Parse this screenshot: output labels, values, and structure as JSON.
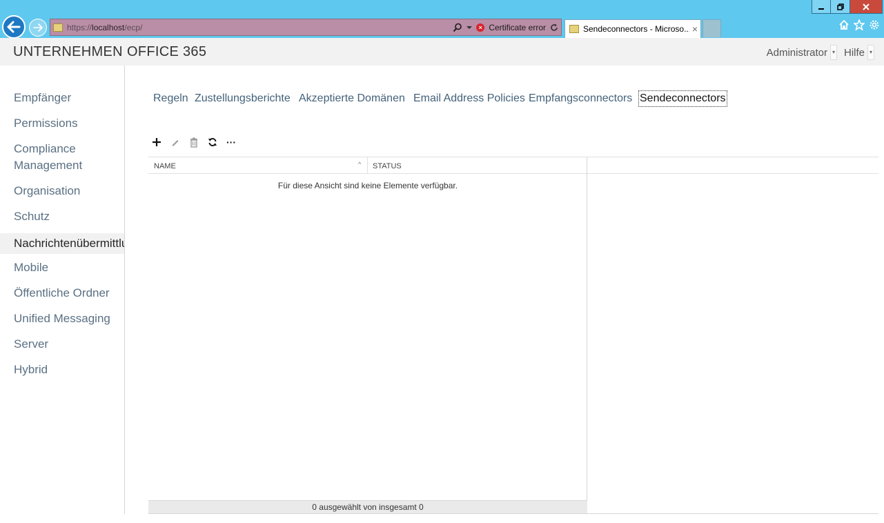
{
  "browser": {
    "url_prefix": "https://",
    "url_host": "localhost",
    "url_path": "/ecp/",
    "certificate_error": "Certificate error",
    "tab_title": "Sendeconnectors - Microso...",
    "window_controls": {
      "minimize": "minimize-icon",
      "restore": "restore-icon",
      "close": "close-icon"
    }
  },
  "header": {
    "brand_primary": "UNTERNEHMEN",
    "brand_secondary": "OFFICE 365",
    "user_menu": "Administrator",
    "help_menu": "Hilfe"
  },
  "sidebar": {
    "items": [
      {
        "label": "Empfänger"
      },
      {
        "label": "Permissions"
      },
      {
        "label": "Compliance"
      },
      {
        "label": "Management"
      },
      {
        "label": "Organisation"
      },
      {
        "label": "Schutz"
      },
      {
        "label": "Nachrichtenübermittlung",
        "active": true
      },
      {
        "label": "Mobile"
      },
      {
        "label": "Öffentliche Ordner"
      },
      {
        "label": "Unified Messaging"
      },
      {
        "label": "Server"
      },
      {
        "label": "Hybrid"
      }
    ]
  },
  "subtabs": [
    {
      "label": "Regeln"
    },
    {
      "label": "Zustellungsberichte"
    },
    {
      "label": "Akzeptierte Domänen"
    },
    {
      "label": "Email Address Policies"
    },
    {
      "label": "Empfangsconnectors"
    },
    {
      "label": "Sendeconnectors",
      "active": true
    }
  ],
  "toolbar": {
    "add": "add-icon",
    "edit": "edit-icon",
    "delete": "delete-icon",
    "refresh": "refresh-icon",
    "more": "more-icon",
    "more_label": "···"
  },
  "grid": {
    "columns": [
      "NAME",
      "STATUS"
    ],
    "sort_indicator": "^",
    "empty_message": "Für diese Ansicht sind keine Elemente verfügbar.",
    "footer": "0 ausgewählt von insgesamt 0"
  },
  "colors": {
    "chrome": "#5ec8ef",
    "addressbar_error": "#b98ea6",
    "nav_text": "#5a7083",
    "accent_link": "#44627a"
  }
}
